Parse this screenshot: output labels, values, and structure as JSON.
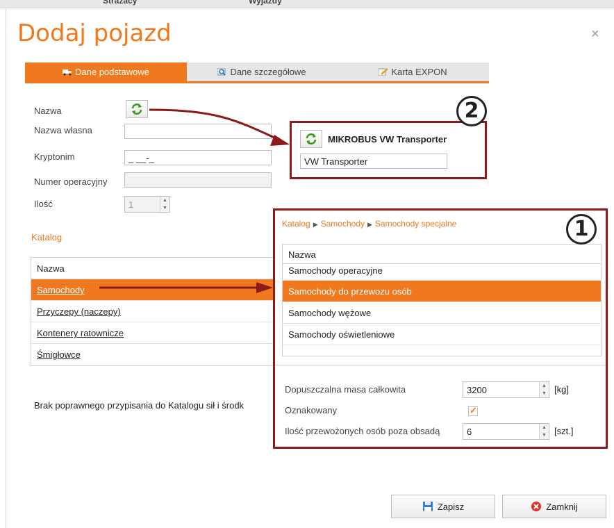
{
  "background_window": {
    "items": [
      "Strażacy",
      "Wyjazdy"
    ]
  },
  "dialog": {
    "title": "Dodaj pojazd",
    "close_glyph": "×",
    "tabs": [
      {
        "label": "Dane podstawowe",
        "icon": "truck-icon",
        "active": true
      },
      {
        "label": "Dane szczegółowe",
        "icon": "magnifier-icon",
        "active": false
      },
      {
        "label": "Karta EXPON",
        "icon": "edit-icon",
        "active": false
      }
    ],
    "fields": {
      "nazwa_label": "Nazwa",
      "nazwa_wlasna_label": "Nazwa własna",
      "nazwa_wlasna_value": "",
      "kryptonim_label": "Kryptonim",
      "kryptonim_value": "_ __-_",
      "numer_operacyjny_label": "Numer operacyjny",
      "numer_operacyjny_value": "",
      "ilosc_label": "Ilość",
      "ilosc_value": "1"
    },
    "catalog": {
      "section_label": "Katalog",
      "header": "Nazwa",
      "items": [
        "Samochody",
        "Przyczepy (naczepy)",
        "Kontenery ratownicze",
        "Śmigłowce"
      ],
      "selected_index": 0
    },
    "status_text": "Brak poprawnego przypisania do Katalogu sił i środk",
    "callout1": {
      "badge": "1",
      "breadcrumb": [
        "Katalog",
        "Samochody",
        "Samochody specjalne"
      ],
      "list_header": "Nazwa",
      "list_items": [
        "Samochody operacyjne",
        "Samochody do przewozu osób",
        "Samochody wężowe",
        "Samochody oświetleniowe"
      ],
      "selected_index": 1,
      "mass_label": "Dopuszczalna masa całkowita",
      "mass_value": "3200",
      "mass_unit": "[kg]",
      "marked_label": "Oznakowany",
      "marked_checked": true,
      "persons_label": "Ilość przewożonych osób poza obsadą",
      "persons_value": "6",
      "persons_unit": "[szt.]"
    },
    "callout2": {
      "badge": "2",
      "vehicle_name": "MIKROBUS VW Transporter",
      "own_name_value": "VW Transporter"
    },
    "buttons": {
      "save_label": "Zapisz",
      "close_label": "Zamknij"
    },
    "colors": {
      "accent": "#f0781e",
      "callout_border": "#8b1a1a",
      "refresh_green": "#3a9a1e"
    }
  }
}
